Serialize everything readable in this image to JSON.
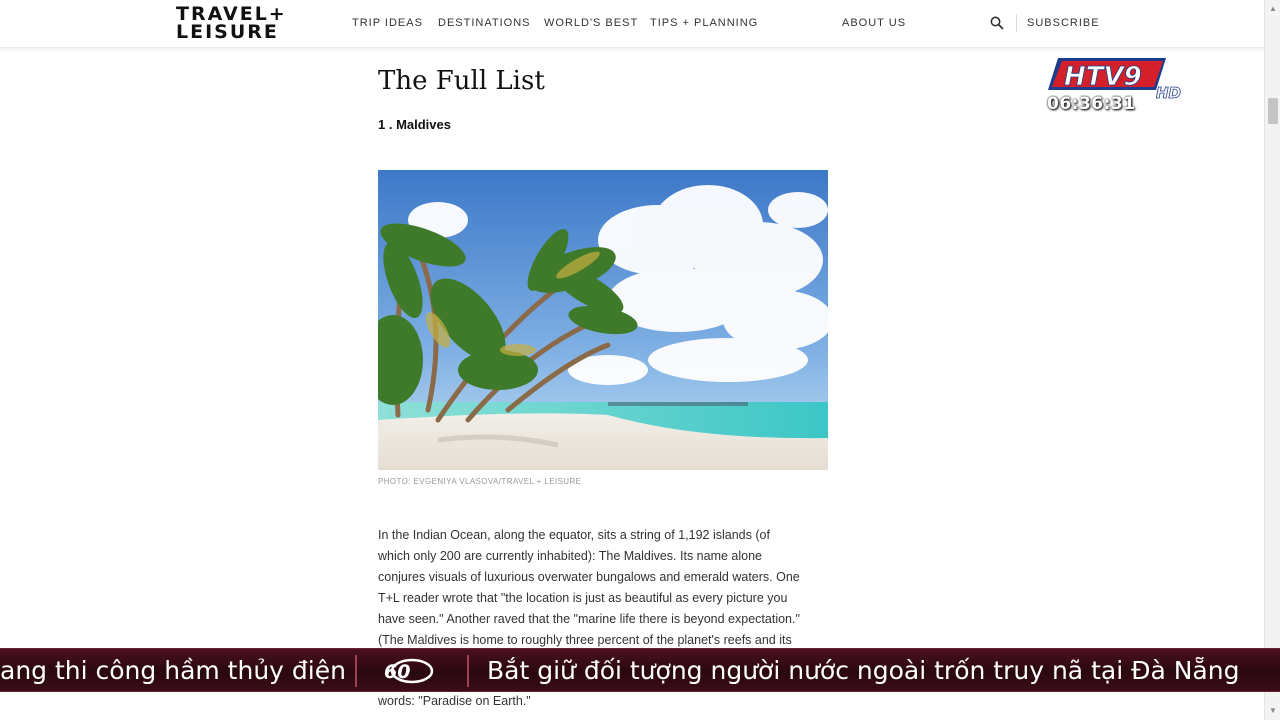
{
  "header": {
    "logo_line1": "TRAVEL+",
    "logo_line2": "LEISURE",
    "nav": [
      "TRIP IDEAS",
      "DESTINATIONS",
      "WORLD'S BEST",
      "TIPS + PLANNING",
      "ABOUT US"
    ],
    "subscribe": "SUBSCRIBE",
    "search_icon": "search-icon"
  },
  "article": {
    "title": "The Full List",
    "item_title": "1 . Maldives",
    "photo_caption": "PHOTO: EVGENIYA VLASOVA/TRAVEL + LEISURE",
    "body_lines": [
      "In the Indian Ocean, along the equator, sits a string of 1,192 islands (of",
      "which only 200 are currently inhabited): The Maldives. Its name alone",
      "conjures visuals of luxurious overwater bungalows and emerald waters. One",
      "T+L reader wrote that \"the location is just as beautiful as every picture you",
      "have seen.\" Another raved that the \"marine life there is beyond expectation.\"",
      "(The Maldives is home to roughly three percent of the planet's reefs and its"
    ],
    "last_line": "words: \"Paradise on Earth.\""
  },
  "overlay": {
    "channel": "HTV9",
    "hd": "HD",
    "clock": "06:36:31"
  },
  "ticker": {
    "text_left": "ang thi công hầm thủy điện",
    "logo": "60",
    "text_right": "Bắt giữ đối tượng người nước ngoài trốn truy nã tại Đà Nẵng"
  },
  "colors": {
    "ticker_bg": "#2a0810",
    "htv_red": "#d4202a",
    "htv_blue": "#1e3c8c"
  }
}
